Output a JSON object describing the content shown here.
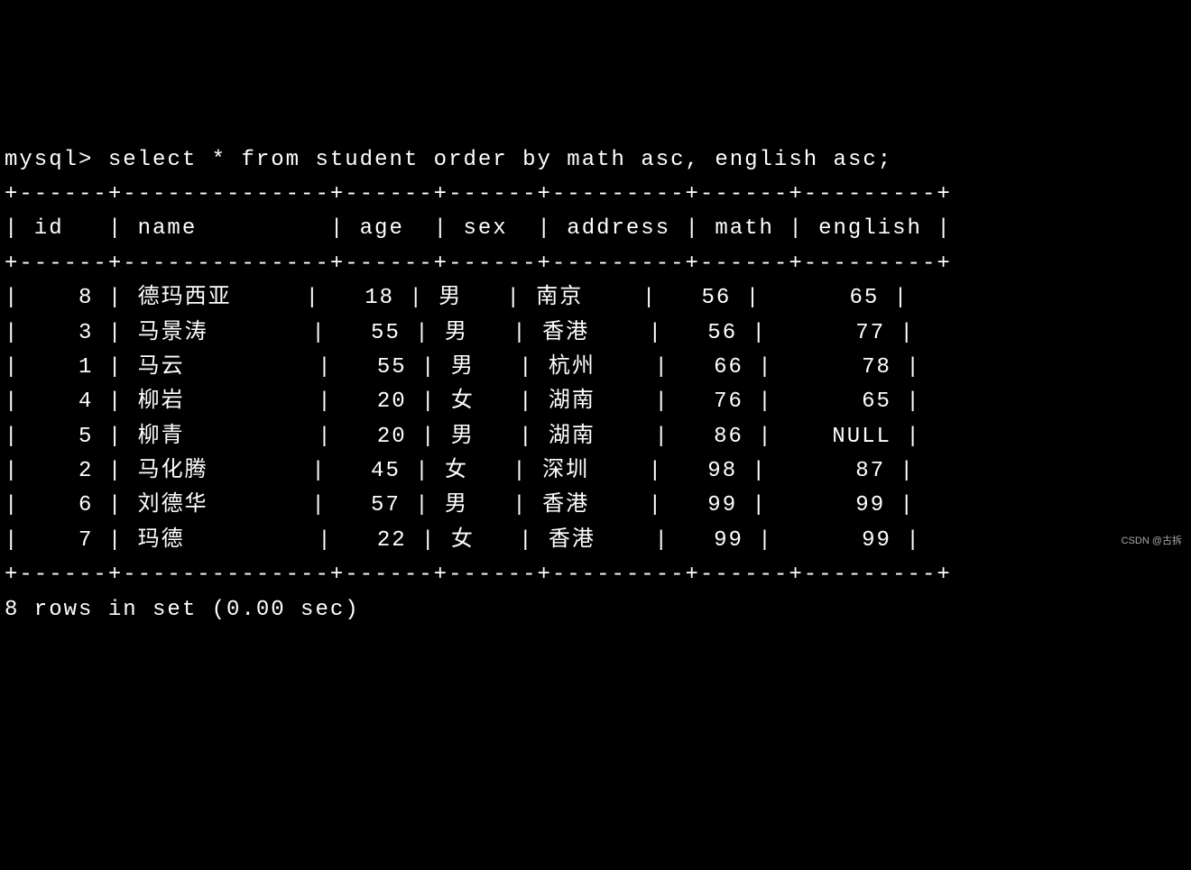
{
  "prompt": "mysql> ",
  "query": "select * from student order by math asc, english asc;",
  "border_top": "+------+--------------+------+------+---------+------+---------+",
  "header": "| id   | name         | age  | sex  | address | math | english |",
  "border_mid": "+------+--------------+------+------+---------+------+---------+",
  "rows": [
    "|    8 | 德玛西亚     |   18 | 男   | 南京    |   56 |      65 |",
    "|    3 | 马景涛       |   55 | 男   | 香港    |   56 |      77 |",
    "|    1 | 马云         |   55 | 男   | 杭州    |   66 |      78 |",
    "|    4 | 柳岩         |   20 | 女   | 湖南    |   76 |      65 |",
    "|    5 | 柳青         |   20 | 男   | 湖南    |   86 |    NULL |",
    "|    2 | 马化腾       |   45 | 女   | 深圳    |   98 |      87 |",
    "|    6 | 刘德华       |   57 | 男   | 香港    |   99 |      99 |",
    "|    7 | 玛德         |   22 | 女   | 香港    |   99 |      99 |"
  ],
  "border_bottom": "+------+--------------+------+------+---------+------+---------+",
  "footer": "8 rows in set (0.00 sec)",
  "watermark": "CSDN @古拆",
  "chart_data": {
    "type": "table",
    "columns": [
      "id",
      "name",
      "age",
      "sex",
      "address",
      "math",
      "english"
    ],
    "data": [
      {
        "id": 8,
        "name": "德玛西亚",
        "age": 18,
        "sex": "男",
        "address": "南京",
        "math": 56,
        "english": 65
      },
      {
        "id": 3,
        "name": "马景涛",
        "age": 55,
        "sex": "男",
        "address": "香港",
        "math": 56,
        "english": 77
      },
      {
        "id": 1,
        "name": "马云",
        "age": 55,
        "sex": "男",
        "address": "杭州",
        "math": 66,
        "english": 78
      },
      {
        "id": 4,
        "name": "柳岩",
        "age": 20,
        "sex": "女",
        "address": "湖南",
        "math": 76,
        "english": 65
      },
      {
        "id": 5,
        "name": "柳青",
        "age": 20,
        "sex": "男",
        "address": "湖南",
        "math": 86,
        "english": null
      },
      {
        "id": 2,
        "name": "马化腾",
        "age": 45,
        "sex": "女",
        "address": "深圳",
        "math": 98,
        "english": 87
      },
      {
        "id": 6,
        "name": "刘德华",
        "age": 57,
        "sex": "男",
        "address": "香港",
        "math": 99,
        "english": 99
      },
      {
        "id": 7,
        "name": "玛德",
        "age": 22,
        "sex": "女",
        "address": "香港",
        "math": 99,
        "english": 99
      }
    ]
  }
}
